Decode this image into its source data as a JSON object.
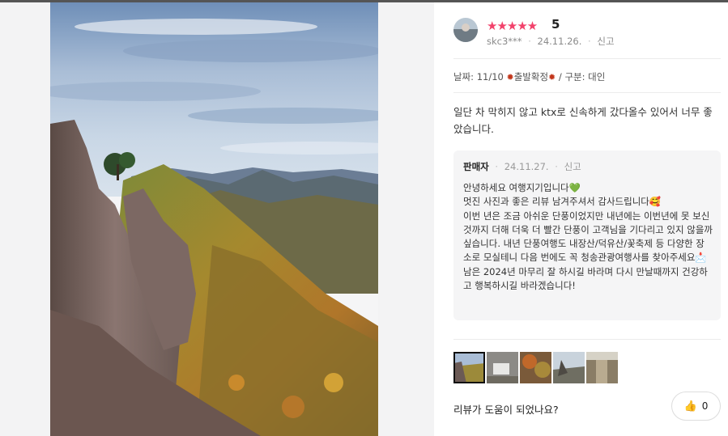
{
  "review": {
    "rating_stars": "★★★★★",
    "rating_value": "5",
    "user_id": "skc3***",
    "date": "24.11.26.",
    "report_label": "신고",
    "info_date_label": "날짜: 11/10",
    "info_status": "출발확정",
    "info_type": "/ 구분: 대인",
    "content": "일단 차 막히지 않고 ktx로 신속하게 갔다올수 있어서 너무 좋았습니다."
  },
  "reply": {
    "seller_label": "판매자",
    "date": "24.11.27.",
    "report_label": "신고",
    "lines": [
      "안녕하세요 여행지기입니다💚",
      "멋진 사진과 좋은 리뷰 남겨주셔서 감사드립니다🥰",
      "이번 년은 조금 아쉬운 단풍이었지만 내년에는 이번년에 못 보신 것까지 더해 더욱 더 빨간 단풍이 고객님을 기다리고 있지 않을까 싶습니다. 내년 단풍여행도 내장산/덕유산/꽃축제 등 다양한 장소로 모실테니 다음 번에도 꼭 청송관광여행사를 찾아주세요📩",
      "남은 2024년 마무리 잘 하시길 바라며 다시 만날때까지 건강하고 행복하시길 바라겠습니다!"
    ]
  },
  "footer": {
    "helpful_question": "리뷰가 도움이 되었나요?",
    "like_count": "0"
  },
  "icons": {
    "leaf": "maple-leaf-icon",
    "like": "thumbs-up-icon"
  },
  "colors": {
    "star": "#f2426b",
    "leaf": "#c2361b"
  }
}
